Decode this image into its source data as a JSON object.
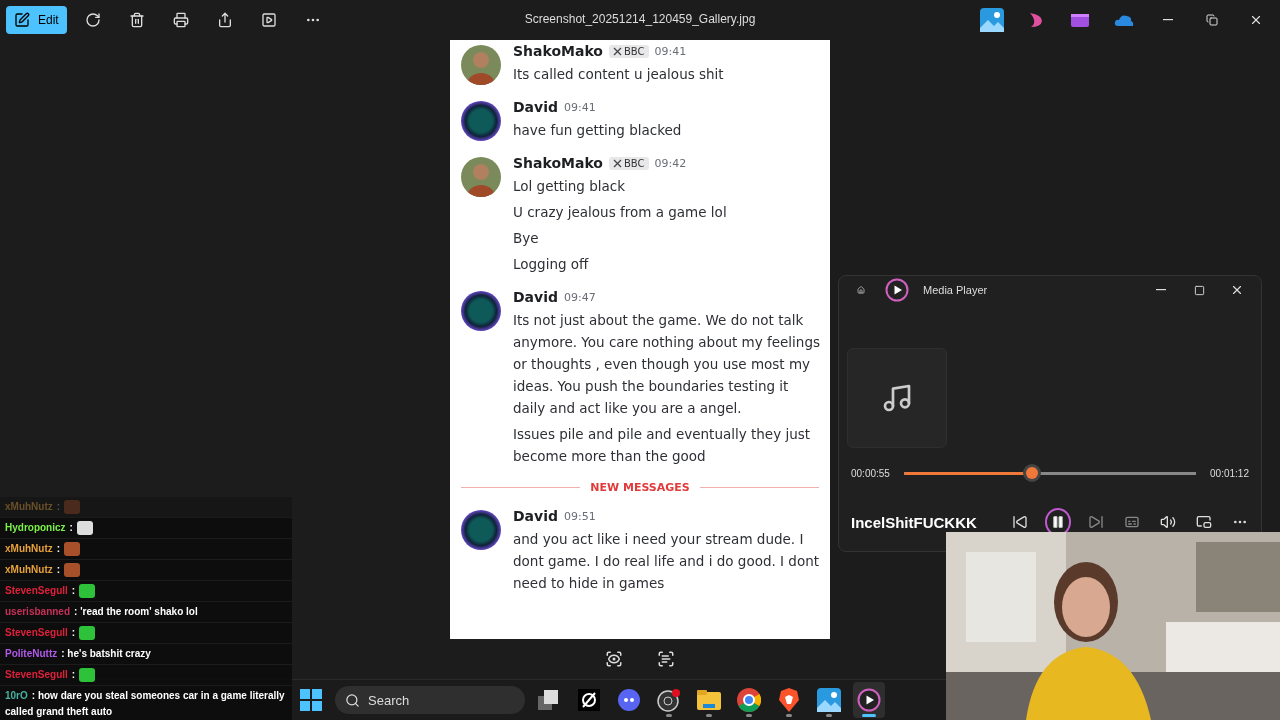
{
  "toolbar": {
    "edit_label": "Edit",
    "title": "Screenshot_20251214_120459_Gallery.jpg"
  },
  "discord": {
    "groups": [
      {
        "author": "ShakoMako",
        "badge": "BBC",
        "time": "09:41",
        "lines": [
          "Its called content u jealous shit"
        ]
      },
      {
        "kind": "ring",
        "author": "David",
        "time": "09:41",
        "lines": [
          "have fun getting blacked"
        ]
      },
      {
        "author": "ShakoMako",
        "badge": "BBC",
        "time": "09:42",
        "lines": [
          "Lol getting black",
          "U crazy jealous from a game lol",
          "Bye",
          "Logging off"
        ]
      },
      {
        "kind": "ring",
        "author": "David",
        "time": "09:47",
        "lines": [
          "Its not just about the game. We do not talk anymore. You care nothing about my feelings or thoughts , even though you use most my ideas. You push the boundaries testing it daily and act like you are a angel.",
          "Issues pile and pile and eventually they just become more than the good"
        ]
      },
      {
        "kind": "divider",
        "label": "NEW MESSAGES"
      },
      {
        "kind": "ring",
        "author": "David",
        "time": "09:51",
        "lines": [
          "and you act like i need your stream dude. I dont game. I do real life and i do good. I dont need to hide in games"
        ]
      }
    ]
  },
  "chat": [
    {
      "kind": "face",
      "name": "xMuhNutz",
      "color": "#6a5028",
      "faded": true,
      "text": ":"
    },
    {
      "kind": "cat",
      "name": "Hydroponicz",
      "color": "#7cf04a",
      "faded": false,
      "text": ":"
    },
    {
      "kind": "face",
      "name": "xMuhNutz",
      "color": "#e8a23a",
      "faded": false,
      "text": ":"
    },
    {
      "kind": "face",
      "name": "xMuhNutz",
      "color": "#e8a23a",
      "faded": false,
      "text": ":"
    },
    {
      "kind": "frog",
      "name": "StevenSegull",
      "color": "#e0203a",
      "faded": false,
      "text": ":"
    },
    {
      "kind": "text",
      "name": "userisbanned",
      "color": "#c8305a",
      "faded": false,
      "text": ": 'read the room' shako lol"
    },
    {
      "kind": "frog",
      "name": "StevenSegull",
      "color": "#e0203a",
      "faded": false,
      "text": ":"
    },
    {
      "kind": "text",
      "name": "PoliteNuttz",
      "color": "#b05ae8",
      "faded": false,
      "text": ": he's batshit crazy"
    },
    {
      "kind": "frog",
      "name": "StevenSegull",
      "color": "#e0203a",
      "faded": false,
      "text": ":"
    },
    {
      "kind": "text",
      "name": "10rO",
      "color": "#4ab0a0",
      "faded": false,
      "text": ": how dare you steal someones car in a game literally called grand theft auto"
    }
  ],
  "player": {
    "title": "Media Player",
    "current": "00:00:55",
    "total": "00:01:12",
    "level": 0.44,
    "track": "IncelShitFUCKKK",
    "playing": true
  },
  "taskbar": {
    "search_placeholder": "Search",
    "apps": [
      {
        "kind": "taskview",
        "running": false,
        "selected": false
      },
      {
        "kind": "slash",
        "running": false,
        "selected": false
      },
      {
        "kind": "discord",
        "running": false,
        "selected": false
      },
      {
        "kind": "obs",
        "running": true,
        "selected": false
      },
      {
        "kind": "folder",
        "running": true,
        "selected": false
      },
      {
        "kind": "chrome",
        "running": true,
        "selected": false
      },
      {
        "kind": "brave",
        "running": true,
        "selected": false
      },
      {
        "kind": "photos",
        "running": true,
        "selected": false
      },
      {
        "kind": "player",
        "running": true,
        "selected": true
      }
    ]
  }
}
